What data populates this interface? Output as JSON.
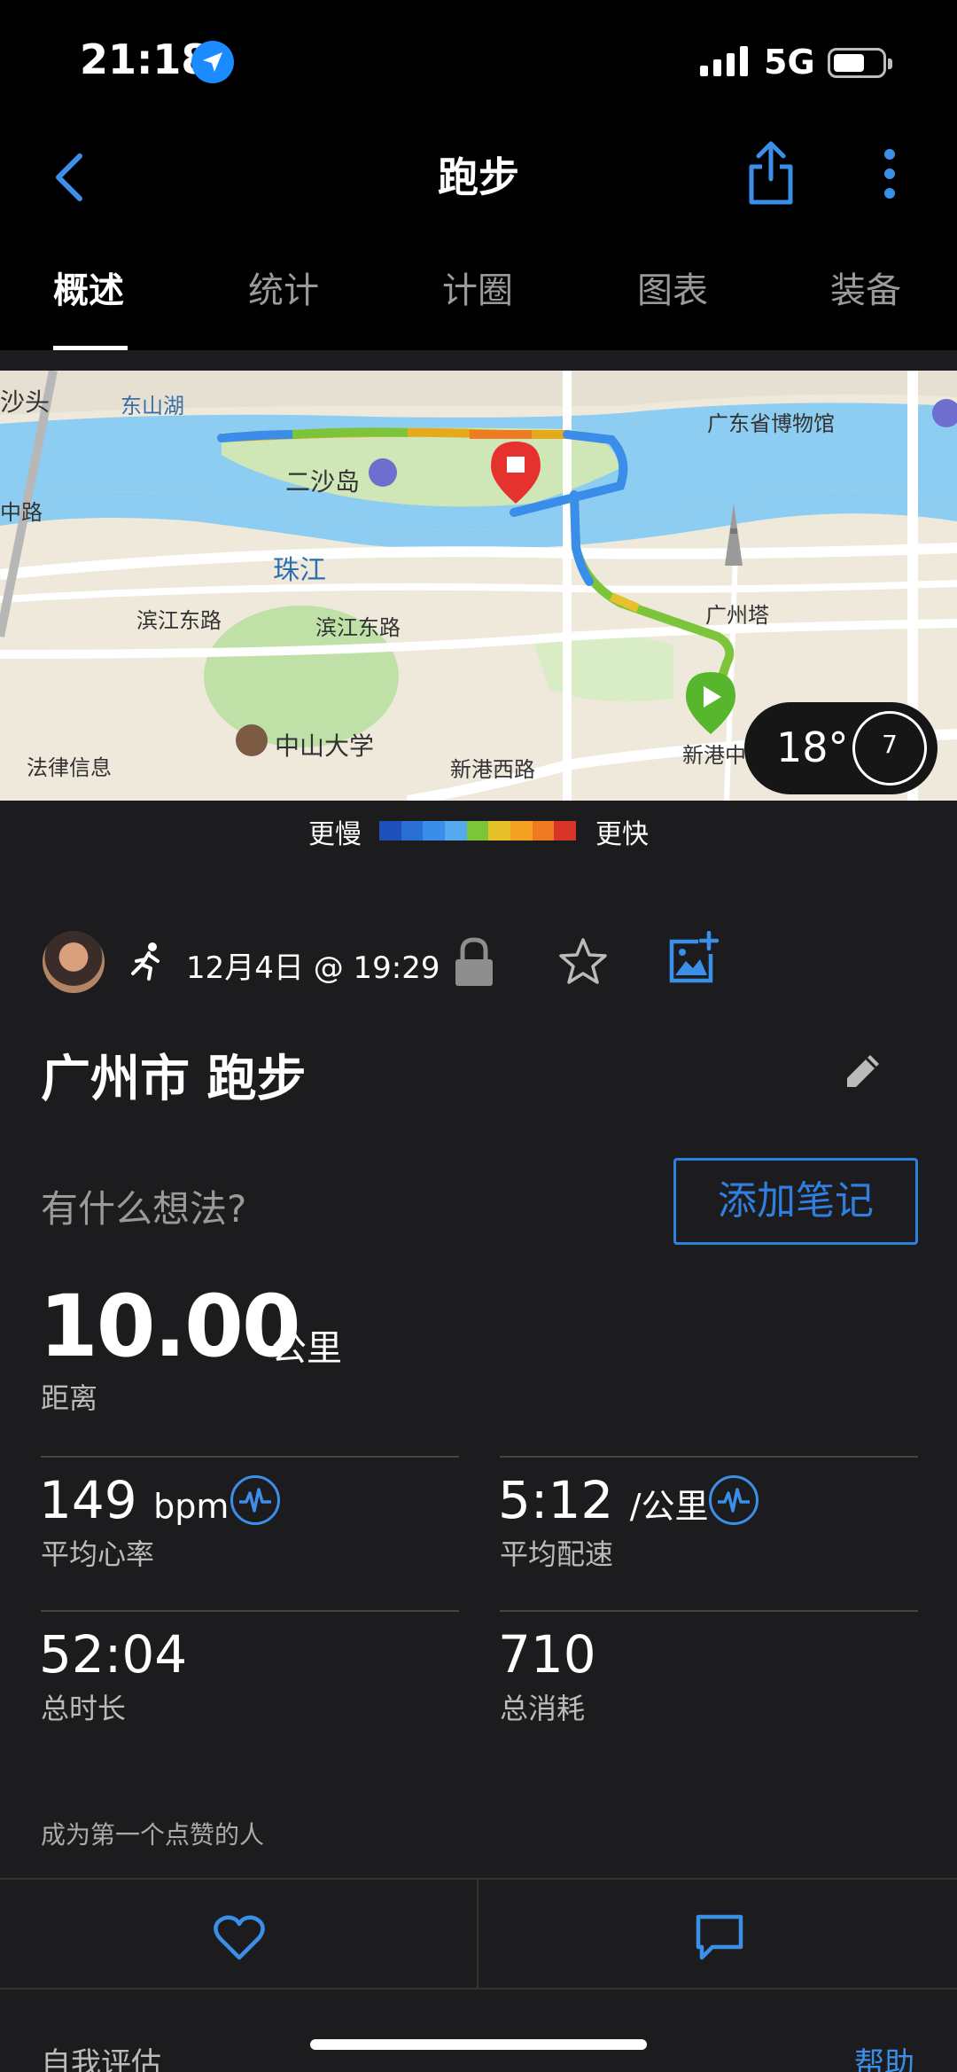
{
  "status_bar": {
    "time": "21:18",
    "network": "5G"
  },
  "nav": {
    "title": "跑步"
  },
  "tabs": [
    {
      "label": "概述",
      "active": true
    },
    {
      "label": "统计",
      "active": false
    },
    {
      "label": "计圈",
      "active": false
    },
    {
      "label": "图表",
      "active": false
    },
    {
      "label": "装备",
      "active": false
    }
  ],
  "map": {
    "labels": [
      "沙头",
      "东山湖",
      "广东省博物馆",
      "二沙岛",
      "珠江",
      "中路",
      "广州塔",
      "滨江东路",
      "滨江东路",
      "中山大学",
      "法律信息",
      "新港西路",
      "新港中"
    ],
    "weather": {
      "temp": "18°",
      "wind": "7"
    }
  },
  "legend": {
    "slower": "更慢",
    "faster": "更快",
    "colors": [
      "#1f4fb8",
      "#2a6fd6",
      "#3a8de8",
      "#56a8ef",
      "#7cc43a",
      "#e6c12a",
      "#f3a224",
      "#ee7b22",
      "#d9342a"
    ]
  },
  "activity": {
    "datetime": "12月4日 @ 19:29",
    "title": "广州市 跑步",
    "thoughts_placeholder": "有什么想法?",
    "add_note": "添加笔记"
  },
  "stats": {
    "distance": {
      "value": "10.00",
      "unit": "公里",
      "label": "距离"
    },
    "avg_hr": {
      "value": "149",
      "unit": "bpm",
      "label": "平均心率"
    },
    "avg_pace": {
      "value": "5:12",
      "unit": "/公里",
      "label": "平均配速"
    },
    "total_time": {
      "value": "52:04",
      "label": "总时长"
    },
    "calories": {
      "value": "710",
      "label": "总消耗"
    }
  },
  "social": {
    "likes_text": "成为第一个点赞的人"
  },
  "footer": {
    "self_eval": "自我评估",
    "help": "帮助"
  },
  "colors": {
    "accent": "#2f7fe0",
    "background": "#1c1c1e"
  }
}
